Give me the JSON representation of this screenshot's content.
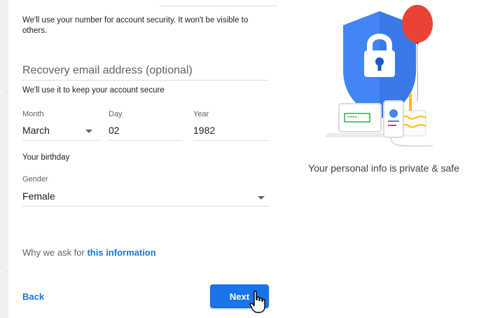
{
  "form": {
    "phone_helper": "We'll use your number for account security. It won't be visible to others.",
    "recovery_placeholder": "Recovery email address (optional)",
    "recovery_helper": "We'll use it to keep your account secure",
    "month": {
      "label": "Month",
      "value": "March"
    },
    "day": {
      "label": "Day",
      "value": "02"
    },
    "year": {
      "label": "Year",
      "value": "1982"
    },
    "birthday_helper": "Your birthday",
    "gender": {
      "label": "Gender",
      "value": "Female"
    },
    "why_prefix": "Why we ask for ",
    "why_link": "this information",
    "back_label": "Back",
    "next_label": "Next"
  },
  "side": {
    "caption": "Your personal info is private & safe",
    "password_dots": "****"
  },
  "colors": {
    "accent": "#1a73e8",
    "shield": "#4285f4",
    "balloon": "#ea4335"
  },
  "icons": [
    "lock-icon",
    "shield-icon",
    "balloon-icon",
    "laptop-icon",
    "phone-icon",
    "cake-icon",
    "hand-cursor-icon"
  ]
}
